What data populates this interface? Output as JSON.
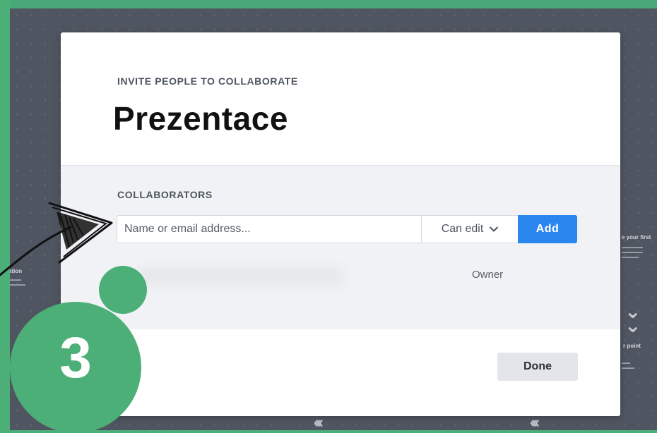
{
  "dialog": {
    "heading": "INVITE PEOPLE TO COLLABORATE",
    "title": "Prezentace",
    "collaborators": {
      "heading": "COLLABORATORS",
      "input_placeholder": "Name or email address...",
      "input_value": "",
      "permission_selected": "Can edit",
      "add_label": "Add",
      "members": [
        {
          "name": "",
          "role": "Owner"
        }
      ]
    },
    "done_label": "Done"
  },
  "step_badge": {
    "number": "3"
  },
  "background": {
    "left_label": "ation",
    "right_label_top": "e your first",
    "right_label_bottom": "r point"
  },
  "colors": {
    "accent_green": "#4caf78",
    "primary_blue": "#2b86f0",
    "backdrop": "#505661"
  },
  "icons": {
    "permission_dropdown": "chevron-down-icon",
    "annotation_arrow": "hand-drawn-arrow-icon"
  }
}
